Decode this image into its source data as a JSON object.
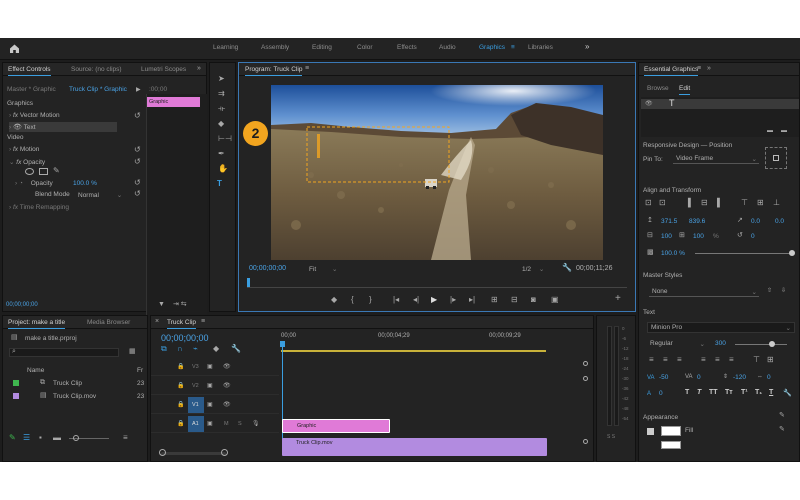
{
  "workspaces": {
    "items": [
      "Learning",
      "Assembly",
      "Editing",
      "Color",
      "Effects",
      "Audio",
      "Graphics",
      "Libraries"
    ],
    "active": "Graphics",
    "overflow": "»"
  },
  "effect_controls": {
    "tabs": [
      "Effect Controls",
      "Source: (no clips)",
      "Lumetri Scopes"
    ],
    "master_label": "Master * Graphic",
    "clip_label": "Truck Clip * Graphic",
    "timecode_ruler": ":00;00",
    "mini_clip": "Graphic",
    "section_graphics": "Graphics",
    "vector_motion": "Vector Motion",
    "text_layer": "Text",
    "section_video": "Video",
    "motion": "Motion",
    "opacity": "Opacity",
    "opacity_label": "Opacity",
    "opacity_value": "100.0 %",
    "blend_mode_label": "Blend Mode",
    "blend_mode_value": "Normal",
    "time_remapping": "Time Remapping",
    "bottom_timecode": "00;00;00;00"
  },
  "program": {
    "title": "Program: Truck Clip",
    "callout": "2",
    "timecode": "00;00;00;00",
    "zoom": "Fit",
    "resolution": "1/2",
    "duration": "00;00;11;26",
    "playhead_fraction": 0.0
  },
  "project": {
    "tabs": [
      "Project: make a title",
      "Media Browser"
    ],
    "file": "make a title.prproj",
    "columns": [
      "Name",
      "Fr"
    ],
    "items": [
      {
        "name": "Truck Clip",
        "fr": "23",
        "color": "#3fb64f"
      },
      {
        "name": "Truck Clip.mov",
        "fr": "23",
        "color": "#b28be0"
      }
    ]
  },
  "timeline": {
    "tab": "Truck Clip",
    "timecode": "00;00;00;00",
    "ruler_labels": [
      "00;00",
      "00;00;04;29",
      "00;00;09;29"
    ],
    "tracks": [
      "V3",
      "V2",
      "V1",
      "A1"
    ],
    "clips": {
      "graphic": "Graphic",
      "video": "Truck Clip.mov"
    }
  },
  "audio_meter": {
    "labels": [
      "0",
      "-6",
      "-12",
      "-18",
      "-24",
      "-30",
      "-36",
      "-42",
      "-48",
      "-54"
    ],
    "solo": "S S"
  },
  "essential_graphics": {
    "title": "Essential Graphics",
    "tabs": [
      "Browse",
      "Edit"
    ],
    "active_tab": "Edit",
    "responsive_design": "Responsive Design — Position",
    "pin_to_label": "Pin To:",
    "pin_to_value": "Video Frame",
    "align_transform": "Align and Transform",
    "pos_x": "371.5",
    "pos_y": "839.6",
    "rotation": "0.0",
    "anchor_x": "0.0",
    "anchor_y": "0.0",
    "scale_w": "100",
    "scale_h": "100",
    "scale_unit": "%",
    "rotate_val": "0",
    "opacity_val": "100.0 %",
    "master_styles": "Master Styles",
    "master_styles_value": "None",
    "text_section": "Text",
    "font": "Minion Pro",
    "font_style": "Regular",
    "font_size": "300",
    "tracking": "-50",
    "kerning": "0",
    "leading": "-120",
    "tsume": "0",
    "baseline": "0",
    "stroke": "0",
    "appearance": "Appearance",
    "fill_label": "Fill"
  },
  "colors": {
    "accent": "#3a9ee0",
    "graphic_clip": "#e07ad7",
    "video_clip": "#b28be0",
    "callout": "#f2a51f",
    "title_box": "#f2a51f"
  }
}
